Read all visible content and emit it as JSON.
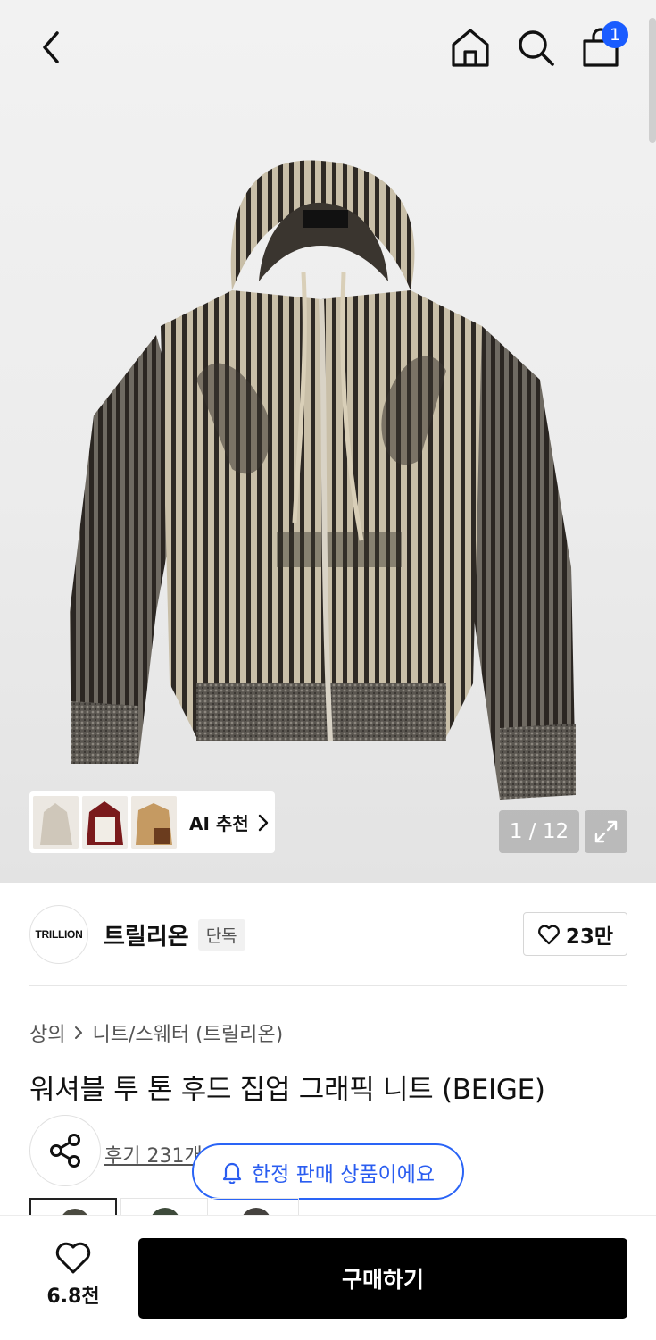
{
  "header": {
    "back_icon": "chevron-left-icon",
    "home_icon": "home-icon",
    "search_icon": "search-icon",
    "cart_icon": "shopping-bag-icon",
    "cart_count": "1"
  },
  "gallery": {
    "ai_recommend_label": "AI 추천",
    "counter": "1 / 12",
    "expand_icon": "expand-icon"
  },
  "brand": {
    "logo_text": "TRILLION",
    "name": "트릴리온",
    "badge": "단독",
    "like_count": "23만"
  },
  "breadcrumb": {
    "items": [
      "상의",
      "니트/스웨터 (트릴리온)"
    ]
  },
  "product": {
    "title": "워셔블 투 톤 후드 집업 그래픽 니트 (BEIGE)",
    "review_text": "후기 231개"
  },
  "toast": {
    "text": "한정 판매 상품이에요"
  },
  "bottom": {
    "wish_count": "6.8천",
    "buy_label": "구매하기"
  },
  "colors": {
    "accent_blue": "#1a5cff",
    "buy_button": "#000000"
  }
}
